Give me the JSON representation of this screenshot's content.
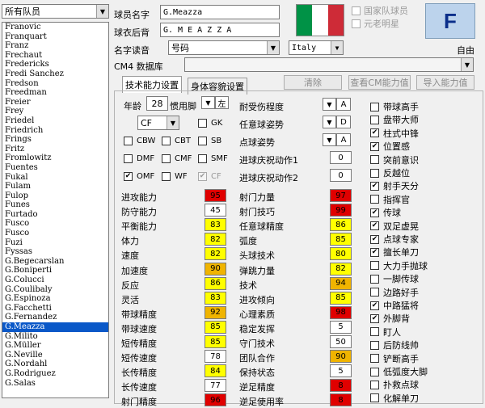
{
  "team_filter": "所有队员",
  "players": [
    "Franovic",
    "Franquart",
    "Franz",
    "Frechaut",
    "Fredericks",
    "Fredi Sanchez",
    "Fredson",
    "Freedman",
    "Freier",
    "Frey",
    "Friedel",
    "Friedrich",
    "Frings",
    "Fritz",
    "Fromlowitz",
    "Fuentes",
    "Fukal",
    "Fulam",
    "Fulop",
    "Funes",
    "Furtado",
    "Fusco",
    "Fusco",
    "Fuzi",
    "Fyssas",
    "G.Begecarslan",
    "G.Boniperti",
    "G.Colucci",
    "G.Coulibaly",
    "G.Espinoza",
    "G.Facchetti",
    "G.Fernandez",
    "G.Meazza",
    "G.Milito",
    "G.Müller",
    "G.Neville",
    "G.Nordahl",
    "G.Rodriguez",
    "G.Salas"
  ],
  "selected_player": "G.Meazza",
  "labels": {
    "player_name": "球员名字",
    "shirt_name": "球衣后背",
    "pronunciation": "名字读音",
    "cm4_db": "CM4 数据库",
    "national_player": "国家队球员",
    "veteran": "元老明星",
    "free": "自由",
    "age": "年龄",
    "foot": "惯用脚"
  },
  "values": {
    "player_name": "G.Meazza",
    "shirt_name": "G. M E A Z Z A",
    "pronunciation": "号码",
    "nationality": "Italy",
    "age": "28",
    "foot": "左",
    "position": "CF"
  },
  "flag_colors": [
    "#009246",
    "#ffffff",
    "#ce2b37"
  ],
  "badge_letter": "F",
  "buttons": {
    "clear": "清除",
    "view_cm": "查看CM能力值",
    "import": "导入能力值"
  },
  "tabs": [
    "技术能力设置",
    "身体容貌设置"
  ],
  "positions": [
    {
      "label": "GK",
      "checked": false
    },
    {
      "label": "CBW",
      "checked": false
    },
    {
      "label": "CBT",
      "checked": false
    },
    {
      "label": "SB",
      "checked": false
    },
    {
      "label": "DMF",
      "checked": false
    },
    {
      "label": "CMF",
      "checked": false
    },
    {
      "label": "SMF",
      "checked": false
    },
    {
      "label": "OMF",
      "checked": true
    },
    {
      "label": "WF",
      "checked": false
    },
    {
      "label": "CF",
      "checked": true
    }
  ],
  "mid_settings": [
    {
      "label": "耐受伤程度",
      "value": "A"
    },
    {
      "label": "任意球姿势",
      "value": "D"
    },
    {
      "label": "点球姿势",
      "value": "A"
    },
    {
      "label": "进球庆祝动作1",
      "value": "0"
    },
    {
      "label": "进球庆祝动作2",
      "value": "0"
    }
  ],
  "stats_left": [
    {
      "label": "进攻能力",
      "value": "95",
      "color": "#e00000"
    },
    {
      "label": "防守能力",
      "value": "45",
      "color": "#ffffff"
    },
    {
      "label": "平衡能力",
      "value": "83",
      "color": "#ffff00"
    },
    {
      "label": "体力",
      "value": "82",
      "color": "#ffff00"
    },
    {
      "label": "速度",
      "value": "82",
      "color": "#ffff00"
    },
    {
      "label": "加速度",
      "value": "90",
      "color": "#f0b400"
    },
    {
      "label": "反应",
      "value": "86",
      "color": "#ffff00"
    },
    {
      "label": "灵活",
      "value": "83",
      "color": "#ffff00"
    },
    {
      "label": "带球精度",
      "value": "92",
      "color": "#f0b400"
    },
    {
      "label": "带球速度",
      "value": "85",
      "color": "#ffff00"
    },
    {
      "label": "短传精度",
      "value": "85",
      "color": "#ffff00"
    },
    {
      "label": "短传速度",
      "value": "78",
      "color": "#ffffff"
    },
    {
      "label": "长传精度",
      "value": "84",
      "color": "#ffff00"
    },
    {
      "label": "长传速度",
      "value": "77",
      "color": "#ffffff"
    },
    {
      "label": "射门精度",
      "value": "96",
      "color": "#e00000"
    }
  ],
  "stats_right": [
    {
      "label": "射门力量",
      "value": "97",
      "color": "#e00000"
    },
    {
      "label": "射门技巧",
      "value": "99",
      "color": "#e00000"
    },
    {
      "label": "任意球精度",
      "value": "86",
      "color": "#ffff00"
    },
    {
      "label": "弧度",
      "value": "85",
      "color": "#ffff00"
    },
    {
      "label": "头球技术",
      "value": "80",
      "color": "#ffff00"
    },
    {
      "label": "弹跳力量",
      "value": "82",
      "color": "#ffff00"
    },
    {
      "label": "技术",
      "value": "94",
      "color": "#f0b400"
    },
    {
      "label": "进攻倾向",
      "value": "85",
      "color": "#ffff00"
    },
    {
      "label": "心理素质",
      "value": "98",
      "color": "#e00000"
    },
    {
      "label": "稳定发挥",
      "value": "5",
      "color": "#ffffff"
    },
    {
      "label": "守门技术",
      "value": "50",
      "color": "#ffffff"
    },
    {
      "label": "团队合作",
      "value": "90",
      "color": "#f0b400"
    },
    {
      "label": "保持状态",
      "value": "5",
      "color": "#ffffff"
    },
    {
      "label": "逆足精度",
      "value": "8",
      "color": "#e00000"
    },
    {
      "label": "逆足使用率",
      "value": "8",
      "color": "#e00000"
    }
  ],
  "skills": [
    {
      "label": "带球高手",
      "checked": false
    },
    {
      "label": "盘带大师",
      "checked": false
    },
    {
      "label": "柱式中锋",
      "checked": true
    },
    {
      "label": "位置感",
      "checked": true
    },
    {
      "label": "突前意识",
      "checked": false
    },
    {
      "label": "反越位",
      "checked": false
    },
    {
      "label": "射手天分",
      "checked": true
    },
    {
      "label": "指挥官",
      "checked": false
    },
    {
      "label": "传球",
      "checked": true
    },
    {
      "label": "双足虚晃",
      "checked": true
    },
    {
      "label": "点球专家",
      "checked": true
    },
    {
      "label": "擅长单刀",
      "checked": true
    },
    {
      "label": "大力手抛球",
      "checked": false
    },
    {
      "label": "一脚传球",
      "checked": false
    },
    {
      "label": "边路好手",
      "checked": false
    },
    {
      "label": "中路猛将",
      "checked": true
    },
    {
      "label": "外脚背",
      "checked": true
    },
    {
      "label": "盯人",
      "checked": false
    },
    {
      "label": "后防线帅",
      "checked": false
    },
    {
      "label": "铲断高手",
      "checked": false
    },
    {
      "label": "低弧度大脚",
      "checked": false
    },
    {
      "label": "扑救点球",
      "checked": false
    },
    {
      "label": "化解单刀",
      "checked": false
    }
  ]
}
